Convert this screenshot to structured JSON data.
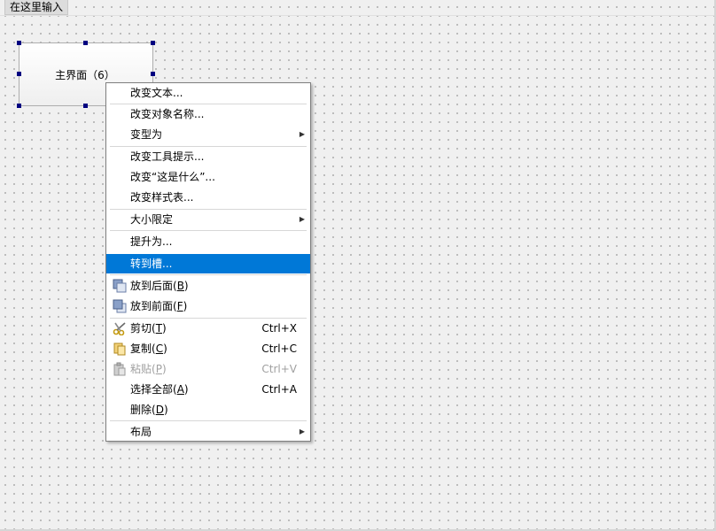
{
  "menubar": {
    "placeholder_item": "在这里输入"
  },
  "widget": {
    "label": "主界面（6）"
  },
  "context_menu": {
    "items": [
      {
        "label": "改变文本..."
      },
      {
        "label": "改变对象名称..."
      },
      {
        "label": "变型为",
        "submenu": true
      },
      {
        "label": "改变工具提示..."
      },
      {
        "label": "改变“这是什么”..."
      },
      {
        "label": "改变样式表..."
      },
      {
        "label": "大小限定",
        "submenu": true
      },
      {
        "label": "提升为..."
      },
      {
        "label": "转到槽...",
        "highlighted": true
      },
      {
        "label_pre": "放到后面(",
        "mnemonic": "B",
        "label_post": ")",
        "icon": "send-to-back-icon"
      },
      {
        "label_pre": "放到前面(",
        "mnemonic": "F",
        "label_post": ")",
        "icon": "bring-to-front-icon"
      },
      {
        "label_pre": "剪切(",
        "mnemonic": "T",
        "label_post": ")",
        "shortcut": "Ctrl+X",
        "icon": "scissors-icon"
      },
      {
        "label_pre": "复制(",
        "mnemonic": "C",
        "label_post": ")",
        "shortcut": "Ctrl+C",
        "icon": "copy-icon"
      },
      {
        "label_pre": "粘贴(",
        "mnemonic": "P",
        "label_post": ")",
        "shortcut": "Ctrl+V",
        "icon": "paste-icon",
        "disabled": true
      },
      {
        "label_pre": "选择全部(",
        "mnemonic": "A",
        "label_post": ")",
        "shortcut": "Ctrl+A"
      },
      {
        "label_pre": "删除(",
        "mnemonic": "D",
        "label_post": ")"
      },
      {
        "label": "布局",
        "submenu": true
      }
    ]
  },
  "colors": {
    "highlight": "#0078d7",
    "handle": "#000080",
    "disabled_text": "#a0a0a0"
  }
}
